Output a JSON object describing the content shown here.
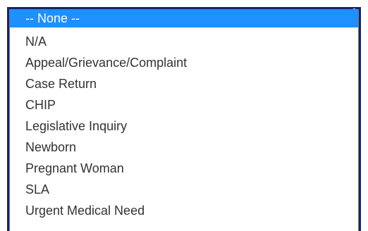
{
  "dropdown": {
    "selected_index": 0,
    "colors": {
      "highlight": "#1e90ff",
      "highlight_text": "#ffffff",
      "text": "#333333",
      "border": "#14246a"
    },
    "options": [
      "-- None --",
      "N/A",
      "Appeal/Grievance/Complaint",
      "Case Return",
      "CHIP",
      "Legislative Inquiry",
      "Newborn",
      "Pregnant Woman",
      "SLA",
      "Urgent Medical Need"
    ]
  }
}
